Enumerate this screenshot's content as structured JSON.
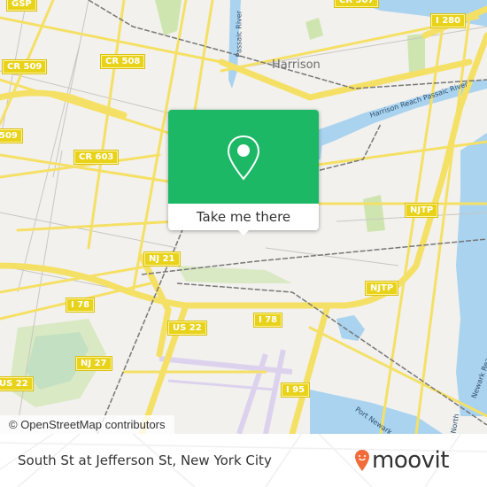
{
  "map": {
    "place_labels": {
      "harrison": "Harrison"
    },
    "water_labels": {
      "harrison_reach": "Harrison Reach Passaic River",
      "passaic_river": "Passaic River",
      "port_newark": "Port Newark",
      "reach_newark": "Newark Reach",
      "north": "North"
    },
    "shields": [
      {
        "id": "gsp",
        "label": "GSP"
      },
      {
        "id": "cr509a",
        "label": "CR 509"
      },
      {
        "id": "cr509b",
        "label": "509"
      },
      {
        "id": "cr508",
        "label": "CR 508"
      },
      {
        "id": "cr507",
        "label": "CR 507"
      },
      {
        "id": "cr603",
        "label": "CR 603"
      },
      {
        "id": "i280",
        "label": "I 280"
      },
      {
        "id": "njtp1",
        "label": "NJTP"
      },
      {
        "id": "njtp2",
        "label": "NJTP"
      },
      {
        "id": "nj21",
        "label": "NJ 21"
      },
      {
        "id": "i78a",
        "label": "I 78"
      },
      {
        "id": "i78b",
        "label": "I 78"
      },
      {
        "id": "us22a",
        "label": "US 22"
      },
      {
        "id": "us22b",
        "label": "US 22"
      },
      {
        "id": "nj27",
        "label": "NJ 27"
      },
      {
        "id": "i95",
        "label": "I 95"
      }
    ],
    "attribution": "© OpenStreetMap contributors",
    "colors": {
      "land": "#f2f1ee",
      "water": "#a9d3ef",
      "park": "#cfe5b0",
      "road": "#f5e066",
      "airport": "#ddd2ee",
      "rail": "#777777"
    }
  },
  "popup": {
    "icon": "map-pin-icon",
    "cta_label": "Take me there",
    "color": "#1db866"
  },
  "footer": {
    "address": "South St at Jefferson St, New York City",
    "brand": "moovit",
    "brand_color": "#f26b3a"
  }
}
